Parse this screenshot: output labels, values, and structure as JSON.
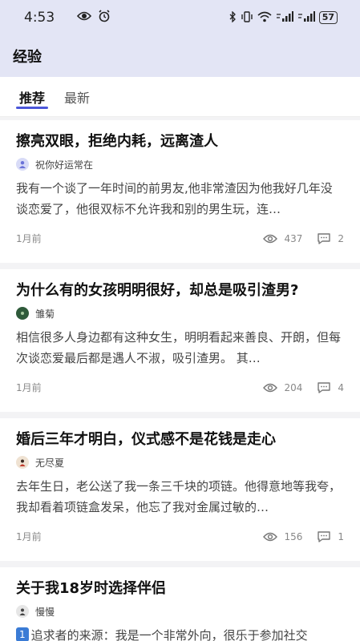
{
  "status": {
    "time": "4:53",
    "battery": "57"
  },
  "appbar": {
    "title": "经验"
  },
  "tabs": [
    {
      "label": "推荐",
      "active": true
    },
    {
      "label": "最新",
      "active": false
    }
  ],
  "posts": [
    {
      "title": "擦亮双眼，拒绝内耗，远离渣人",
      "author": "祝你好运常在",
      "excerpt": "我有一个谈了一年时间的前男友,他非常渣因为他我好几年没谈恋爱了，他很双标不允许我和别的男生玩，连…",
      "time": "1月前",
      "views": "437",
      "comments": "2",
      "avatar_color": "#c9cdf3"
    },
    {
      "title": "为什么有的女孩明明很好，却总是吸引渣男?",
      "author": "雏菊",
      "excerpt": "相信很多人身边都有这种女生，明明看起来善良、开朗，但每次谈恋爱最后都是遇人不淑，吸引渣男。 其…",
      "time": "1月前",
      "views": "204",
      "comments": "4",
      "avatar_color": "#2e5a3a"
    },
    {
      "title": "婚后三年才明白，仪式感不是花钱是走心",
      "author": "无尽夏",
      "excerpt": "去年生日，老公送了我一条三千块的项链。他得意地等我夸，我却看着项链盒发呆，他忘了我对金属过敏的…",
      "time": "1月前",
      "views": "156",
      "comments": "1",
      "avatar_color": "#e8d9c8"
    },
    {
      "title": "关于我18岁时选择伴侣",
      "author": "慢慢",
      "badge": "1",
      "excerpt": "追求者的来源：我是一个非常外向，很乐于参加社交",
      "avatar_color": "#6b6b6b"
    }
  ]
}
